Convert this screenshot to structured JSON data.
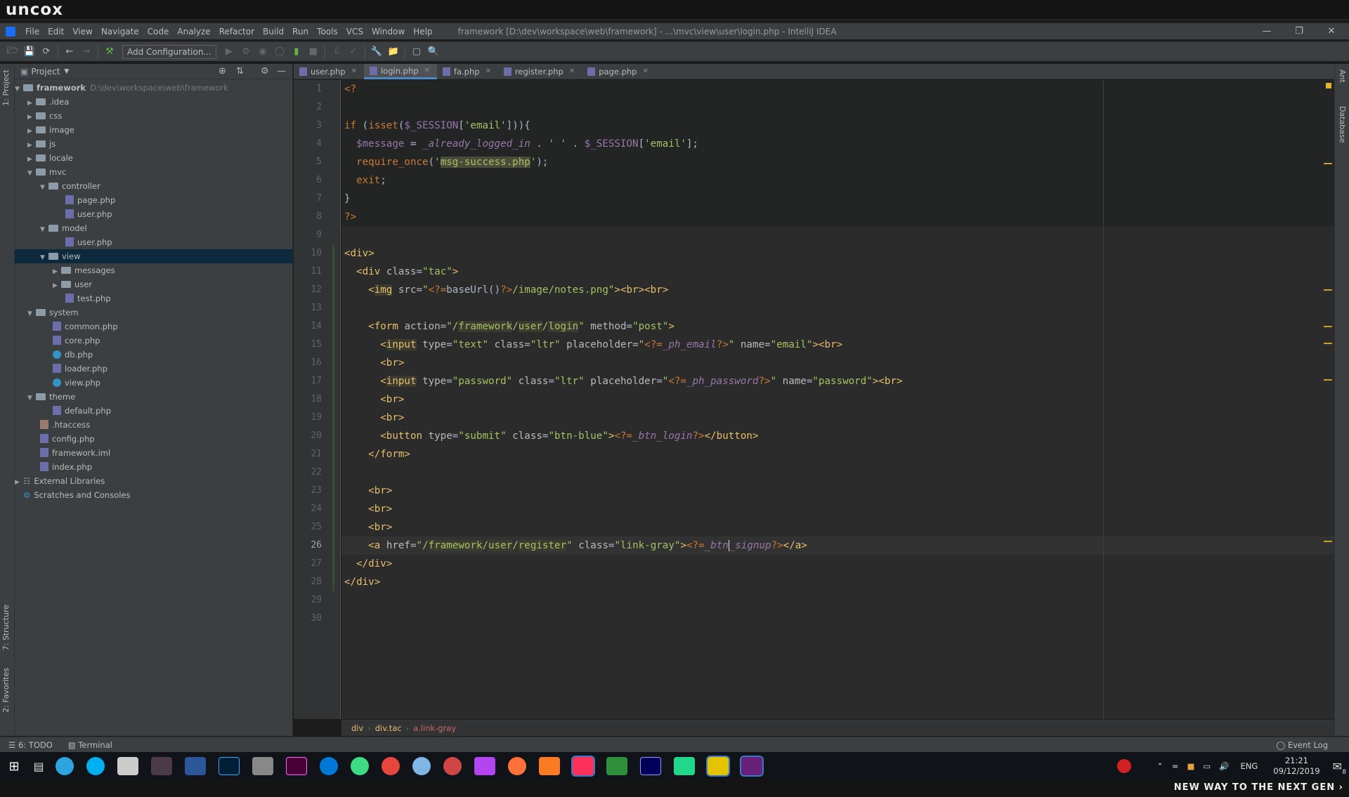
{
  "banner": {
    "logo": "uncox",
    "slogan": "NEW WAY TO THE NEXT GEN ›"
  },
  "menu": {
    "items": [
      "File",
      "Edit",
      "View",
      "Navigate",
      "Code",
      "Analyze",
      "Refactor",
      "Build",
      "Run",
      "Tools",
      "VCS",
      "Window",
      "Help"
    ],
    "window_title": "framework [D:\\dev\\workspace\\web\\framework] - ...\\mvc\\view\\user\\login.php - IntelliJ IDEA"
  },
  "toolbar": {
    "add_config_label": "Add Configuration..."
  },
  "left_strip": {
    "project_tab": "1: Project",
    "structure_tab": "7: Structure",
    "favorites_tab": "2: Favorites"
  },
  "right_strip": {
    "ant_tab": "Ant",
    "database_tab": "Database"
  },
  "project": {
    "title": "Project",
    "root_name": "framework",
    "root_path": "D:\\dev\\workspace\\web\\framework",
    "tree": [
      {
        "label": ".idea"
      },
      {
        "label": "css"
      },
      {
        "label": "image"
      },
      {
        "label": "js"
      },
      {
        "label": "locale"
      },
      {
        "label": "mvc"
      },
      {
        "label": "controller"
      },
      {
        "label": "page.php"
      },
      {
        "label": "user.php"
      },
      {
        "label": "model"
      },
      {
        "label": "user.php"
      },
      {
        "label": "view"
      },
      {
        "label": "messages"
      },
      {
        "label": "user"
      },
      {
        "label": "test.php"
      },
      {
        "label": "system"
      },
      {
        "label": "common.php"
      },
      {
        "label": "core.php"
      },
      {
        "label": "db.php"
      },
      {
        "label": "loader.php"
      },
      {
        "label": "view.php"
      },
      {
        "label": "theme"
      },
      {
        "label": "default.php"
      },
      {
        "label": ".htaccess"
      },
      {
        "label": "config.php"
      },
      {
        "label": "framework.iml"
      },
      {
        "label": "index.php"
      },
      {
        "label": "External Libraries"
      },
      {
        "label": "Scratches and Consoles"
      }
    ]
  },
  "tabs": [
    "user.php",
    "login.php",
    "fa.php",
    "register.php",
    "page.php"
  ],
  "active_tab": "login.php",
  "line_numbers": [
    "1",
    "2",
    "3",
    "4",
    "5",
    "6",
    "7",
    "8",
    "9",
    "10",
    "11",
    "12",
    "13",
    "14",
    "15",
    "16",
    "17",
    "18",
    "19",
    "20",
    "21",
    "22",
    "23",
    "24",
    "25",
    "26",
    "27",
    "28",
    "29",
    "30"
  ],
  "current_line": "26",
  "breadcrumb": [
    "div",
    "div.tac",
    "a.link-gray"
  ],
  "bottom": {
    "todo": "6: TODO",
    "terminal": "Terminal",
    "event_log": "Event Log"
  },
  "tray": {
    "lang": "ENG",
    "time": "21:21",
    "date": "09/12/2019",
    "notif_count": "8"
  },
  "colors": {
    "tag": "#e8bf6a",
    "string": "#a5c261",
    "keyword": "#cc7832",
    "variable": "#9876aa",
    "editor_bg": "#2b2b2b",
    "panel_bg": "#3c3f41",
    "selection": "#0d293e"
  }
}
